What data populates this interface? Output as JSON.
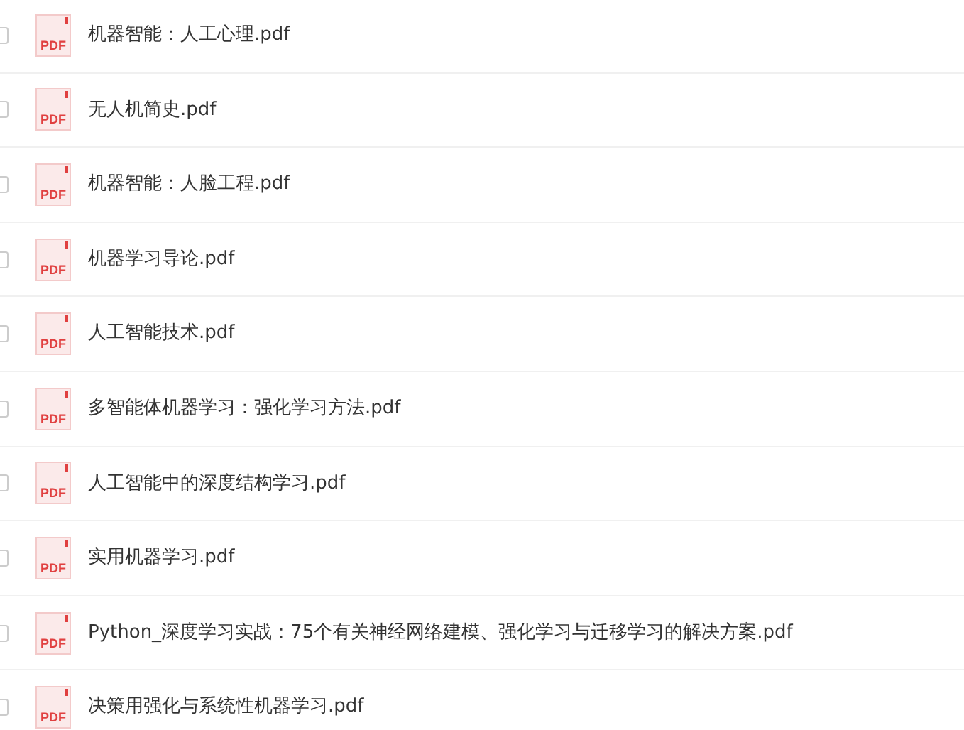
{
  "files": [
    {
      "name": "机器智能：人工心理.pdf",
      "checked": false,
      "icon_label": "PDF"
    },
    {
      "name": "无人机简史.pdf",
      "checked": false,
      "icon_label": "PDF"
    },
    {
      "name": "机器智能：人脸工程.pdf",
      "checked": false,
      "icon_label": "PDF"
    },
    {
      "name": "机器学习导论.pdf",
      "checked": false,
      "icon_label": "PDF"
    },
    {
      "name": "人工智能技术.pdf",
      "checked": false,
      "icon_label": "PDF"
    },
    {
      "name": "多智能体机器学习：强化学习方法.pdf",
      "checked": false,
      "icon_label": "PDF"
    },
    {
      "name": "人工智能中的深度结构学习.pdf",
      "checked": false,
      "icon_label": "PDF"
    },
    {
      "name": "实用机器学习.pdf",
      "checked": false,
      "icon_label": "PDF"
    },
    {
      "name": "Python_深度学习实战：75个有关神经网络建模、强化学习与迁移学习的解决方案.pdf",
      "checked": false,
      "icon_label": "PDF"
    },
    {
      "name": "决策用强化与系统性机器学习.pdf",
      "checked": false,
      "icon_label": "PDF"
    }
  ]
}
